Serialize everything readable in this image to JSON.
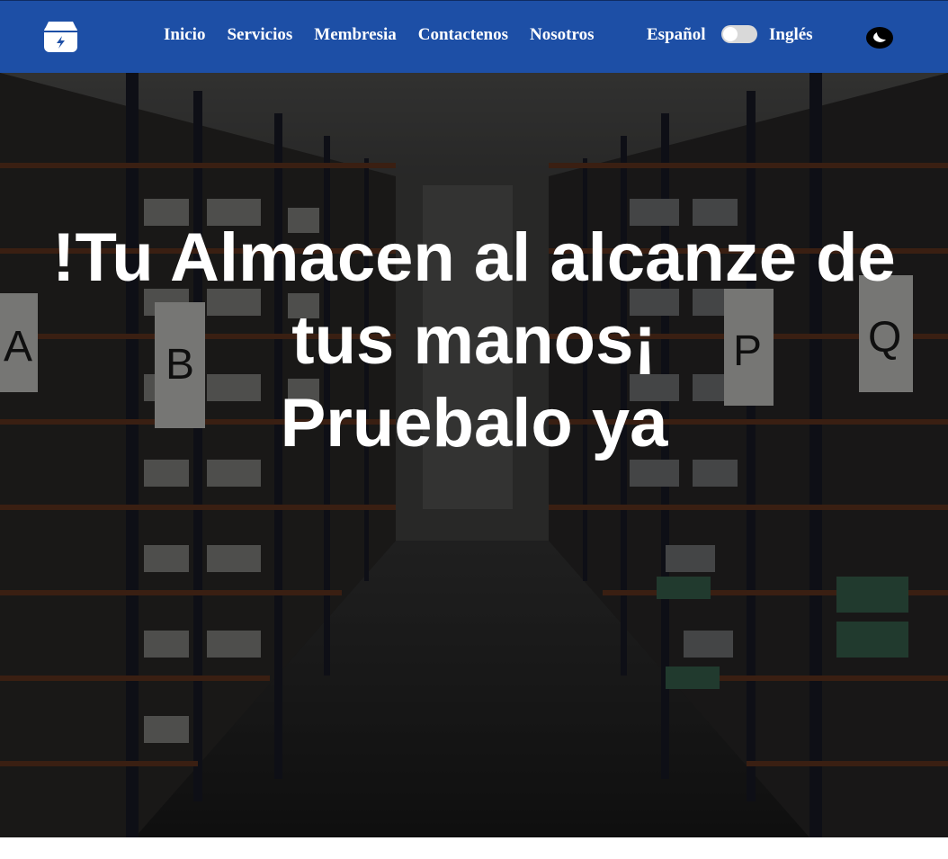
{
  "navbar": {
    "logo_icon": "box-lightning-icon",
    "links": [
      {
        "label": "Inicio"
      },
      {
        "label": "Servicios"
      },
      {
        "label": "Membresia"
      },
      {
        "label": "Contactenos"
      },
      {
        "label": "Nosotros"
      }
    ],
    "language": {
      "left_label": "Español",
      "right_label": "Inglés"
    },
    "theme_icon": "moon-icon",
    "background_color": "#1d4fa6"
  },
  "hero": {
    "title_line1": "!Tu Almacen al alcanze de",
    "title_line2": "tus manos¡",
    "title_line3": "Pruebalo ya",
    "background_image": "warehouse-shelves-aisle"
  }
}
